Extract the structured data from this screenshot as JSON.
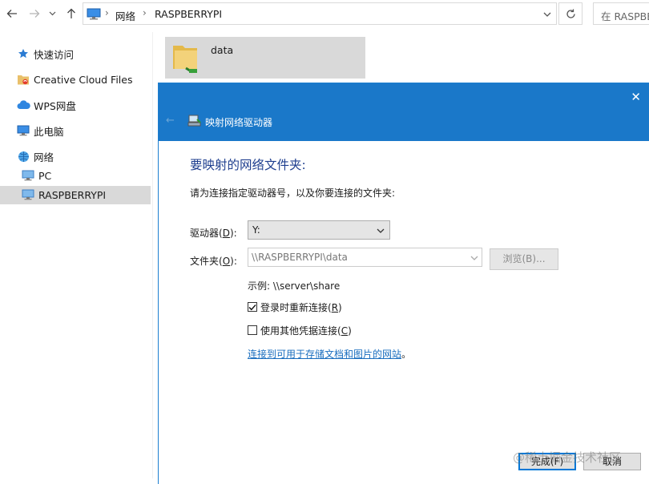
{
  "explorer": {
    "breadcrumb": [
      "网络",
      "RASPBERRYPI"
    ],
    "search_placeholder": "在 RASPBE"
  },
  "sidebar": {
    "items": [
      {
        "label": "快速访问",
        "icon": "star-icon"
      },
      {
        "label": "Creative Cloud Files",
        "icon": "cc-folder-icon"
      },
      {
        "label": "WPS网盘",
        "icon": "cloud-icon"
      },
      {
        "label": "此电脑",
        "icon": "computer-icon"
      },
      {
        "label": "网络",
        "icon": "network-icon"
      },
      {
        "label": "PC",
        "icon": "monitor-icon"
      },
      {
        "label": "RASPBERRYPI",
        "icon": "monitor-icon",
        "selected": true
      }
    ]
  },
  "content": {
    "folder_name": "data"
  },
  "dialog": {
    "title": "映射网络驱动器",
    "heading": "要映射的网络文件夹:",
    "instruction": "请为连接指定驱动器号，以及你要连接的文件夹:",
    "drive_label_pre": "驱动器(",
    "drive_label_key": "D",
    "drive_label_post": "):",
    "drive_value": "Y:",
    "folder_label_pre": "文件夹(",
    "folder_label_key": "O",
    "folder_label_post": "):",
    "folder_value": "\\\\RASPBERRYPI\\data",
    "browse_label": "浏览(B)...",
    "example": "示例: \\\\server\\share",
    "reconnect_pre": "登录时重新连接(",
    "reconnect_key": "R",
    "reconnect_post": ")",
    "reconnect_checked": true,
    "creds_pre": "使用其他凭据连接(",
    "creds_key": "C",
    "creds_post": ")",
    "creds_checked": false,
    "link_text": "连接到可用于存储文档和图片的网站",
    "link_suffix": "。",
    "finish_label": "完成(F)",
    "cancel_label": "取消"
  },
  "watermark": "@稀土掘金技术社区",
  "colors": {
    "accent": "#1a78c9",
    "heading": "#1f3f8f",
    "link": "#1a6ebf",
    "selection": "#d9d9d9"
  }
}
